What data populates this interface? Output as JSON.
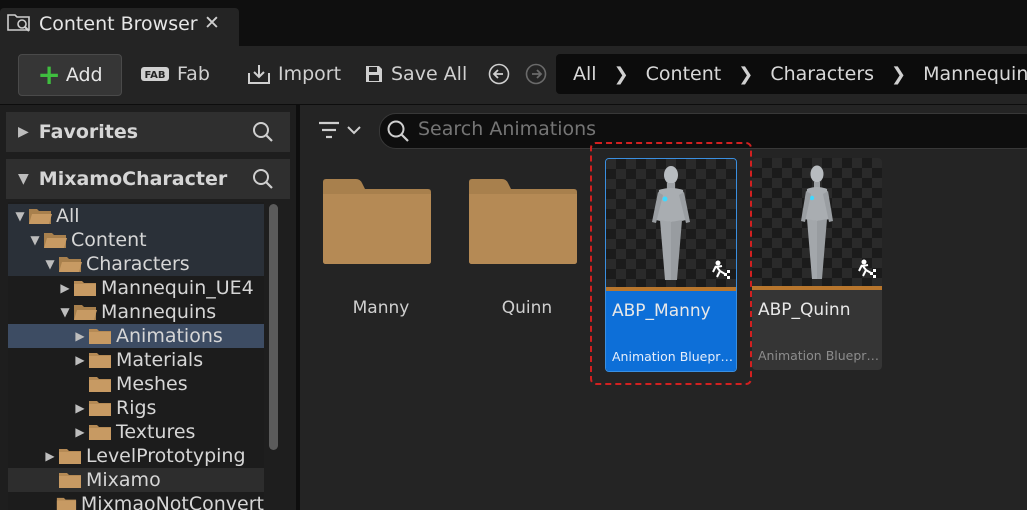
{
  "window": {
    "tab_title": "Content Browser",
    "close_symbol": "✕"
  },
  "toolbar": {
    "add_label": "Add",
    "fab_label": "Fab",
    "import_label": "Import",
    "save_all_label": "Save All"
  },
  "breadcrumb": [
    "All",
    "Content",
    "Characters",
    "Mannequins"
  ],
  "sidebar": {
    "favorites_label": "Favorites",
    "project_label": "MixamoCharacter",
    "tree": [
      {
        "label": "All",
        "depth": 0,
        "expander": "open",
        "folder": "open"
      },
      {
        "label": "Content",
        "depth": 1,
        "expander": "open",
        "folder": "open"
      },
      {
        "label": "Characters",
        "depth": 2,
        "expander": "open",
        "folder": "open"
      },
      {
        "label": "Mannequin_UE4",
        "depth": 3,
        "expander": "closed",
        "folder": "closed"
      },
      {
        "label": "Mannequins",
        "depth": 3,
        "expander": "open",
        "folder": "open"
      },
      {
        "label": "Animations",
        "depth": 4,
        "expander": "closed",
        "folder": "closed",
        "selected": true
      },
      {
        "label": "Materials",
        "depth": 4,
        "expander": "closed",
        "folder": "closed"
      },
      {
        "label": "Meshes",
        "depth": 4,
        "expander": "none",
        "folder": "closed"
      },
      {
        "label": "Rigs",
        "depth": 4,
        "expander": "closed",
        "folder": "closed"
      },
      {
        "label": "Textures",
        "depth": 4,
        "expander": "closed",
        "folder": "closed"
      },
      {
        "label": "LevelPrototyping",
        "depth": 2,
        "expander": "closed",
        "folder": "closed"
      },
      {
        "label": "Mixamo",
        "depth": 2,
        "expander": "none",
        "folder": "closed"
      },
      {
        "label": "MixmaoNotConvert",
        "depth": 2,
        "expander": "none",
        "folder": "closed"
      }
    ]
  },
  "search": {
    "placeholder": "Search Animations",
    "value": ""
  },
  "folders": [
    {
      "label": "Manny"
    },
    {
      "label": "Quinn"
    }
  ],
  "assets": [
    {
      "name": "ABP_Manny",
      "type": "Animation Blueprint",
      "selected": true
    },
    {
      "name": "ABP_Quinn",
      "type": "Animation Blueprint",
      "selected": false
    }
  ],
  "colors": {
    "accent_selected": "#0d6fd8",
    "add_plus": "#3fbe3f",
    "asset_strip": "#b8762d",
    "highlight": "#d22020",
    "folder": "#b58a55"
  },
  "icons": {
    "tab": "content-browser-icon",
    "fab": "fab-logo-icon",
    "import": "import-icon",
    "save_all": "save-all-icon",
    "back": "back-arrow-icon",
    "forward": "forward-arrow-icon",
    "search": "search-icon",
    "filter": "filter-icon",
    "asset_badge": "animation-blueprint-icon"
  }
}
